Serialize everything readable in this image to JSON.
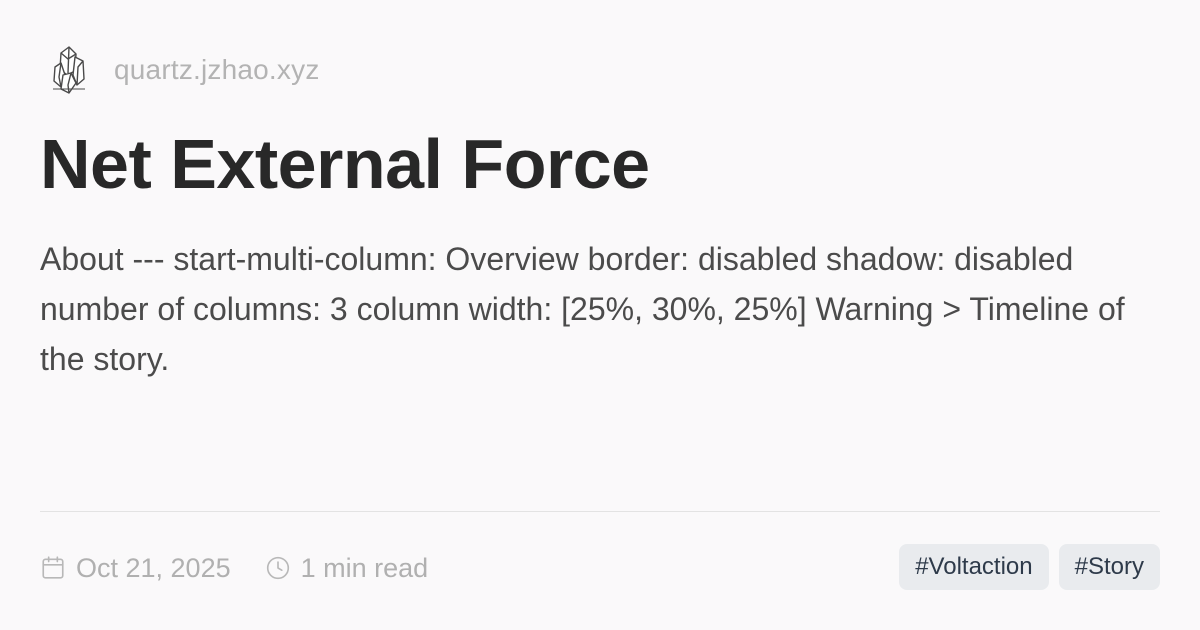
{
  "site": {
    "name": "quartz.jzhao.xyz",
    "logo_icon": "crystal-logo-icon"
  },
  "page": {
    "title": "Net External Force",
    "description": "About --- start-multi-column: Overview border: disabled shadow: disabled number of columns: 3 column width: [25%, 30%, 25%] Warning > Timeline of the story."
  },
  "meta": {
    "date": "Oct 21, 2025",
    "date_icon": "calendar-icon",
    "read_time": "1 min read",
    "read_time_icon": "clock-icon"
  },
  "tags": [
    "#Voltaction",
    "#Story"
  ],
  "colors": {
    "background": "#faf9fa",
    "title": "#282828",
    "muted": "#b0b0b0",
    "tag_bg": "#e9ebee",
    "tag_text": "#2e3a4a"
  }
}
